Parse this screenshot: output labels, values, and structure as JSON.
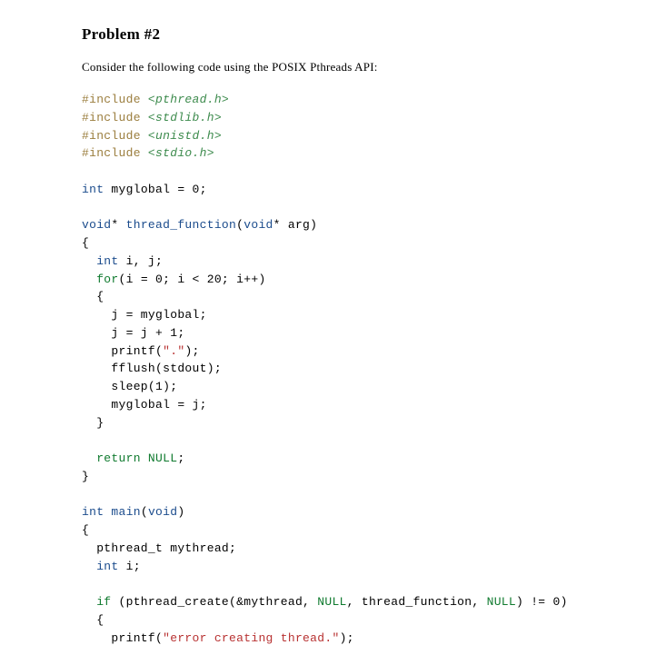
{
  "heading": "Problem #2",
  "intro": "Consider the following code using the POSIX Pthreads API:",
  "code": {
    "includes": [
      {
        "directive": "#include",
        "header": "<pthread.h>"
      },
      {
        "directive": "#include",
        "header": "<stdlib.h>"
      },
      {
        "directive": "#include",
        "header": "<unistd.h>"
      },
      {
        "directive": "#include",
        "header": "<stdio.h>"
      }
    ],
    "global_decl": {
      "type": "int",
      "rest": " myglobal = 0;"
    },
    "thread_fn": {
      "sig_void_star1": "void",
      "sig_name": " thread_function",
      "sig_open": "(",
      "sig_void_star2": "void",
      "sig_close": "* arg)",
      "open_brace": "{",
      "locals": {
        "type": "int",
        "rest": " i, j;"
      },
      "for_kw": "for",
      "for_rest": "(i = 0; i < 20; i++)",
      "for_open": "  {",
      "body_l1": "    j = myglobal;",
      "body_l2": "    j = j + 1;",
      "body_l3_a": "    printf(",
      "body_l3_str": "\".\"",
      "body_l3_b": ");",
      "body_l4": "    fflush(stdout);",
      "body_l5": "    sleep(1);",
      "body_l6": "    myglobal = j;",
      "for_close": "  }",
      "return_kw": "return",
      "return_null": "NULL",
      "return_semi": ";",
      "close_brace": "}"
    },
    "main_fn": {
      "type": "int",
      "name": " main",
      "sig_open": "(",
      "void_kw": "void",
      "sig_close": ")",
      "open_brace": "{",
      "decl1": "  pthread_t mythread;",
      "decl2_type": "int",
      "decl2_rest": " i;",
      "if_kw": "if",
      "if_a": " (pthread_create(&mythread, ",
      "if_null1": "NULL",
      "if_b": ", thread_function, ",
      "if_null2": "NULL",
      "if_c": ") != 0)",
      "if_open": "  {",
      "err_a": "    printf(",
      "err_str": "\"error creating thread.\"",
      "err_b": ");"
    }
  }
}
